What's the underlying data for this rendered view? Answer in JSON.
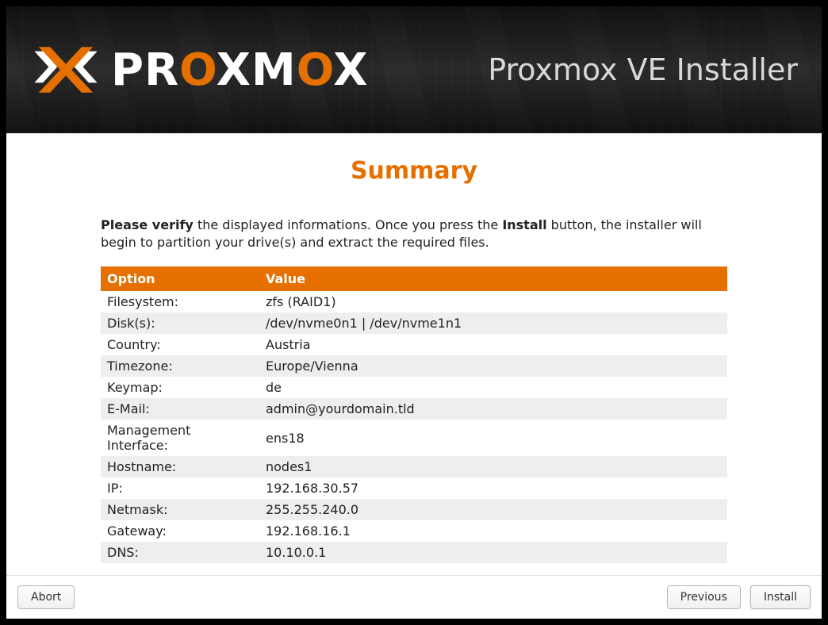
{
  "header": {
    "title": "Proxmox VE Installer",
    "logo_text_parts": [
      "PR",
      "O",
      "XM",
      "O",
      "X"
    ]
  },
  "page": {
    "title": "Summary",
    "intro_bold1": "Please verify",
    "intro_mid": " the displayed informations. Once you press the ",
    "intro_bold2": "Install",
    "intro_end": " button, the installer will begin to partition your drive(s) and extract the required files."
  },
  "table": {
    "header_option": "Option",
    "header_value": "Value",
    "rows": [
      {
        "option": "Filesystem:",
        "value": "zfs (RAID1)"
      },
      {
        "option": "Disk(s):",
        "value": "/dev/nvme0n1 | /dev/nvme1n1"
      },
      {
        "option": "Country:",
        "value": "Austria"
      },
      {
        "option": "Timezone:",
        "value": "Europe/Vienna"
      },
      {
        "option": "Keymap:",
        "value": "de"
      },
      {
        "option": "E-Mail:",
        "value": "admin@yourdomain.tld"
      },
      {
        "option": "Management Interface:",
        "value": "ens18"
      },
      {
        "option": "Hostname:",
        "value": "nodes1"
      },
      {
        "option": "IP:",
        "value": "192.168.30.57"
      },
      {
        "option": "Netmask:",
        "value": "255.255.240.0"
      },
      {
        "option": "Gateway:",
        "value": "192.168.16.1"
      },
      {
        "option": "DNS:",
        "value": "10.10.0.1"
      }
    ]
  },
  "footer": {
    "abort": "Abort",
    "previous": "Previous",
    "install": "Install"
  },
  "colors": {
    "accent": "#e57000"
  }
}
